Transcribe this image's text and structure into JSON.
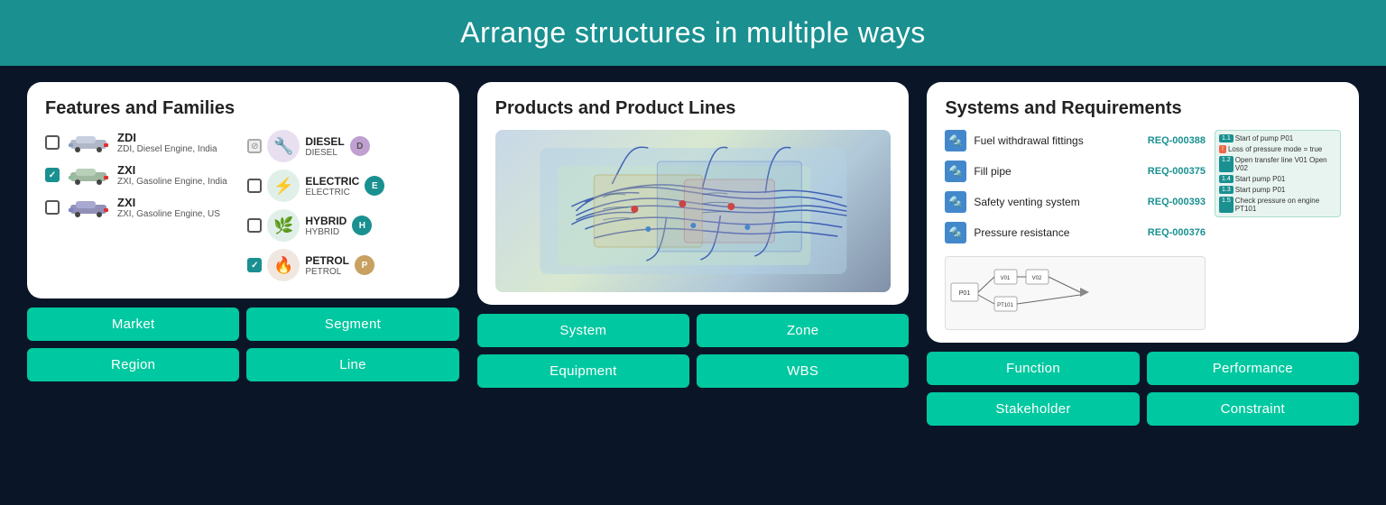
{
  "header": {
    "title": "Arrange structures in multiple ways",
    "bg_color": "#1a9090"
  },
  "columns": [
    {
      "id": "features",
      "card_title": "Features and Families",
      "items_left": [
        {
          "name": "ZDI",
          "desc": "ZDI, Diesel Engine, India",
          "checked": false,
          "disabled": false
        },
        {
          "name": "ZXI",
          "desc": "ZXI, Gasoline Engine, India",
          "checked": true,
          "disabled": false
        },
        {
          "name": "ZXI",
          "desc": "ZXI, Gasoline Engine, US",
          "checked": false,
          "disabled": false
        }
      ],
      "items_right": [
        {
          "name": "DIESEL",
          "sub": "DIESEL",
          "badge": "D",
          "checked_state": "disabled"
        },
        {
          "name": "ELECTRIC",
          "sub": "ELECTRIC",
          "badge": "E",
          "checked_state": "unchecked"
        },
        {
          "name": "HYBRID",
          "sub": "HYBRID",
          "badge": "H",
          "checked_state": "unchecked"
        },
        {
          "name": "PETROL",
          "sub": "PETROL",
          "badge": "P",
          "checked_state": "checked"
        }
      ],
      "tags": [
        "Market",
        "Segment",
        "Region",
        "Line"
      ]
    },
    {
      "id": "products",
      "card_title": "Products and Product Lines",
      "tags": [
        "System",
        "Zone",
        "Equipment",
        "WBS"
      ]
    },
    {
      "id": "systems",
      "card_title": "Systems and Requirements",
      "system_items": [
        {
          "name": "Fuel withdrawal fittings",
          "req": "REQ-000388"
        },
        {
          "name": "Fill pipe",
          "req": "REQ-000375"
        },
        {
          "name": "Safety venting system",
          "req": "REQ-000393"
        },
        {
          "name": "Pressure resistance",
          "req": "REQ-000376"
        }
      ],
      "req_notes": [
        "Start of pump P01",
        "Loss of pressure mode = true",
        "Open transfer line V01 Open V02",
        "Start pump P01",
        "Start pump P01",
        "Check pressure on engine PT101"
      ],
      "tags": [
        "Function",
        "Performance",
        "Stakeholder",
        "Constraint"
      ]
    }
  ]
}
